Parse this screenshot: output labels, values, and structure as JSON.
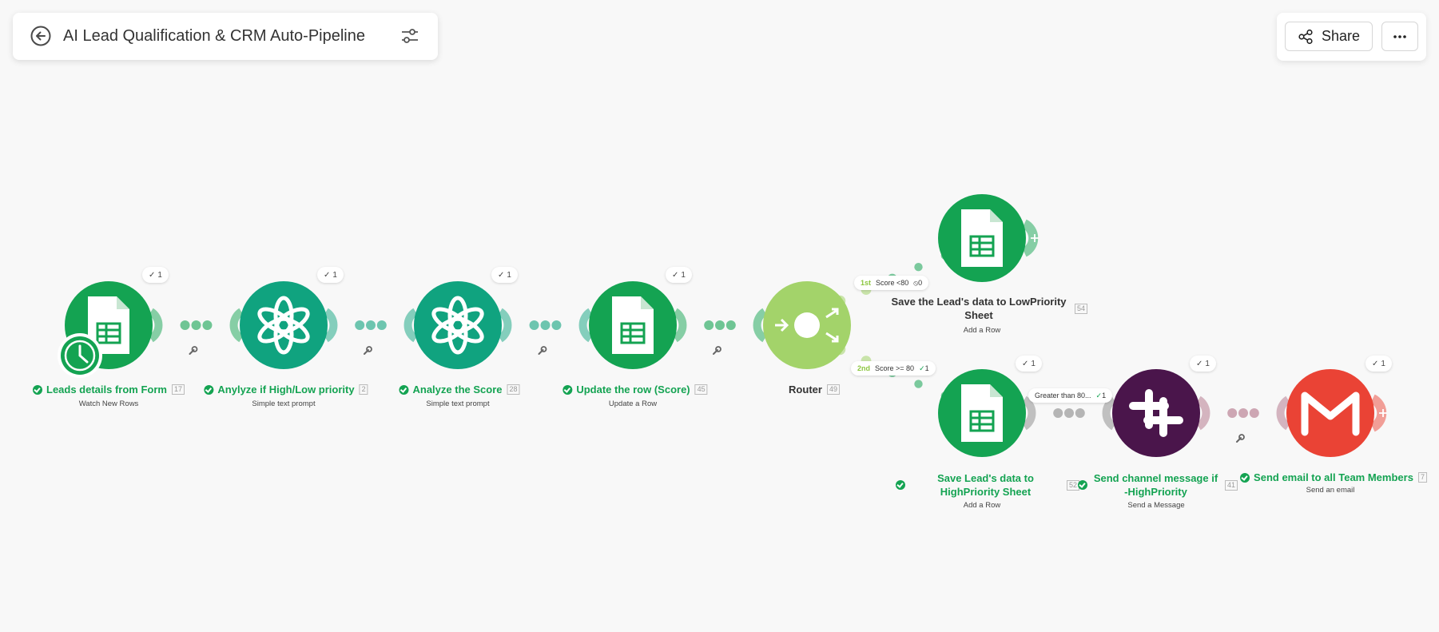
{
  "header": {
    "title": "AI Lead Qualification & CRM Auto-Pipeline"
  },
  "toolbar": {
    "share_label": "Share"
  },
  "modules": [
    {
      "title": "Leads details from Form",
      "num": "17",
      "sub": "Watch New Rows",
      "ops": "1"
    },
    {
      "title": "Anylyze if High/Low priority",
      "num": "2",
      "sub": "Simple text prompt",
      "ops": "1"
    },
    {
      "title": "Analyze the Score",
      "num": "28",
      "sub": "Simple text prompt",
      "ops": "1"
    },
    {
      "title": "Update the row (Score)",
      "num": "45",
      "sub": "Update a Row",
      "ops": "1"
    },
    {
      "title": "Router",
      "num": "49"
    },
    {
      "title": "Save the Lead's data to LowPriority Sheet",
      "num": "54",
      "sub": "Add a Row"
    },
    {
      "title": "Save Lead's data to HighPriority Sheet",
      "num": "52",
      "sub": "Add a Row",
      "ops": "1"
    },
    {
      "title": "Send channel message if -HighPriority",
      "num": "41",
      "sub": "Send a Message",
      "ops": "1"
    },
    {
      "title": "Send email to all Team Members",
      "num": "7",
      "sub": "Send an email",
      "ops": "1"
    }
  ],
  "routes": {
    "route1": {
      "order": "1st",
      "label": "Score <80",
      "count": "0"
    },
    "route2": {
      "order": "2nd",
      "label": "Score >= 80",
      "count": "1"
    },
    "filter3": {
      "label": "Greater than 80...",
      "count": "1"
    }
  },
  "colors": {
    "sheets": "#14a352",
    "openai": "#10a37f",
    "router": "#a3d36a",
    "slack": "#4a154b",
    "gmail": "#ea4335",
    "canvas": "#f8f8f8"
  }
}
